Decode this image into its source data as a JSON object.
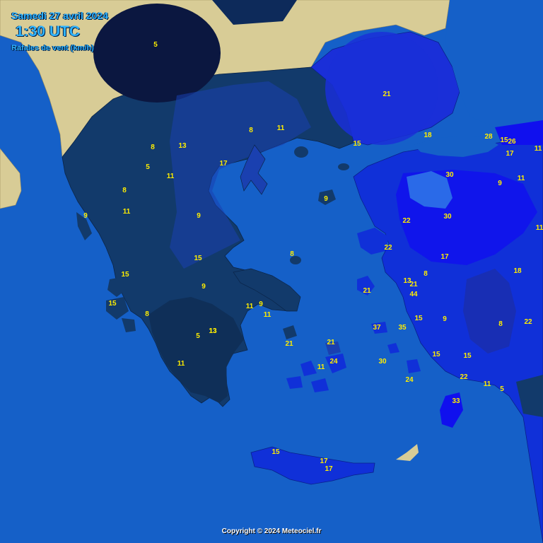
{
  "header": {
    "date": "Samedi 27 avril 2024",
    "time": "1:30 UTC",
    "title": "Rafales de vent (km/h)"
  },
  "footer": {
    "copyright": "Copyright © 2024 Meteociel.fr"
  },
  "legend_colors": {
    "sea": "#1560c8",
    "land_outside": "#d8cc96",
    "gust_0_6": "#0b1740",
    "gust_7_14": "#123a6b",
    "gust_15_25": "#1a40b0",
    "gust_26_35": "#1030d8",
    "gust_36_plus": "#1010ee",
    "label": "#ffee00"
  },
  "station_values": [
    "5",
    "8",
    "11",
    "8",
    "13",
    "5",
    "11",
    "17",
    "8",
    "11",
    "9",
    "11",
    "21",
    "15",
    "18",
    "28",
    "15",
    "26",
    "11",
    "17",
    "9",
    "11",
    "30",
    "9",
    "30",
    "22",
    "22",
    "13",
    "15",
    "15",
    "9",
    "8",
    "15",
    "17",
    "11",
    "9",
    "8",
    "11",
    "9",
    "8",
    "13",
    "21",
    "44",
    "21",
    "18",
    "37",
    "35",
    "15",
    "9",
    "8",
    "22",
    "21",
    "21",
    "5",
    "13",
    "11",
    "11",
    "24",
    "30",
    "24",
    "15",
    "15",
    "22",
    "11",
    "5",
    "33",
    "15",
    "17",
    "17"
  ]
}
